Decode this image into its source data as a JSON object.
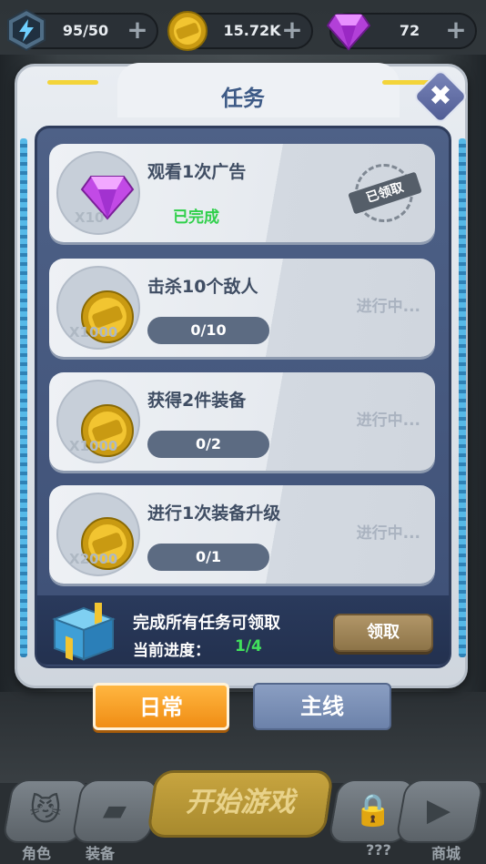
{
  "resources": [
    {
      "name": "energy",
      "value": "95/50",
      "icon": "lightning-icon"
    },
    {
      "name": "coins",
      "value": "15.72K",
      "icon": "coin-icon"
    },
    {
      "name": "gems",
      "value": "72",
      "icon": "gem-icon"
    }
  ],
  "dialog": {
    "title": "任务",
    "close_icon": "close-icon"
  },
  "tasks": [
    {
      "name": "观看1次广告",
      "reward_icon": "gem-icon",
      "reward_qty": "X10",
      "status_text": "已完成",
      "stamp": "已领取"
    },
    {
      "name": "击杀10个敌人",
      "reward_icon": "coin-icon",
      "reward_qty": "X1000",
      "progress": "0/10",
      "state": "进行中..."
    },
    {
      "name": "获得2件装备",
      "reward_icon": "coin-icon",
      "reward_qty": "X1000",
      "progress": "0/2",
      "state": "进行中..."
    },
    {
      "name": "进行1次装备升级",
      "reward_icon": "coin-icon",
      "reward_qty": "X2000",
      "progress": "0/1",
      "state": "进行中..."
    }
  ],
  "reward_bar": {
    "line1": "完成所有任务可领取",
    "line2_label": "当前进度：",
    "line2_value": "1/4",
    "claim_label": "领取"
  },
  "tabs": {
    "daily": "日常",
    "main": "主线"
  },
  "bottom_nav": {
    "start_label": "开始游戏",
    "items": [
      {
        "label": "角色",
        "icon": "cat-face-icon"
      },
      {
        "label": "装备",
        "icon": "gun-icon"
      },
      {
        "label": "???",
        "icon": "lock-icon"
      },
      {
        "label": "商城",
        "icon": "play-icon"
      }
    ]
  },
  "colors": {
    "title": "#3d5a86",
    "done_green": "#31d04c",
    "progress_green": "#41e05c",
    "daily_tab": "#f5a021",
    "main_tab": "#7a8fb6"
  }
}
